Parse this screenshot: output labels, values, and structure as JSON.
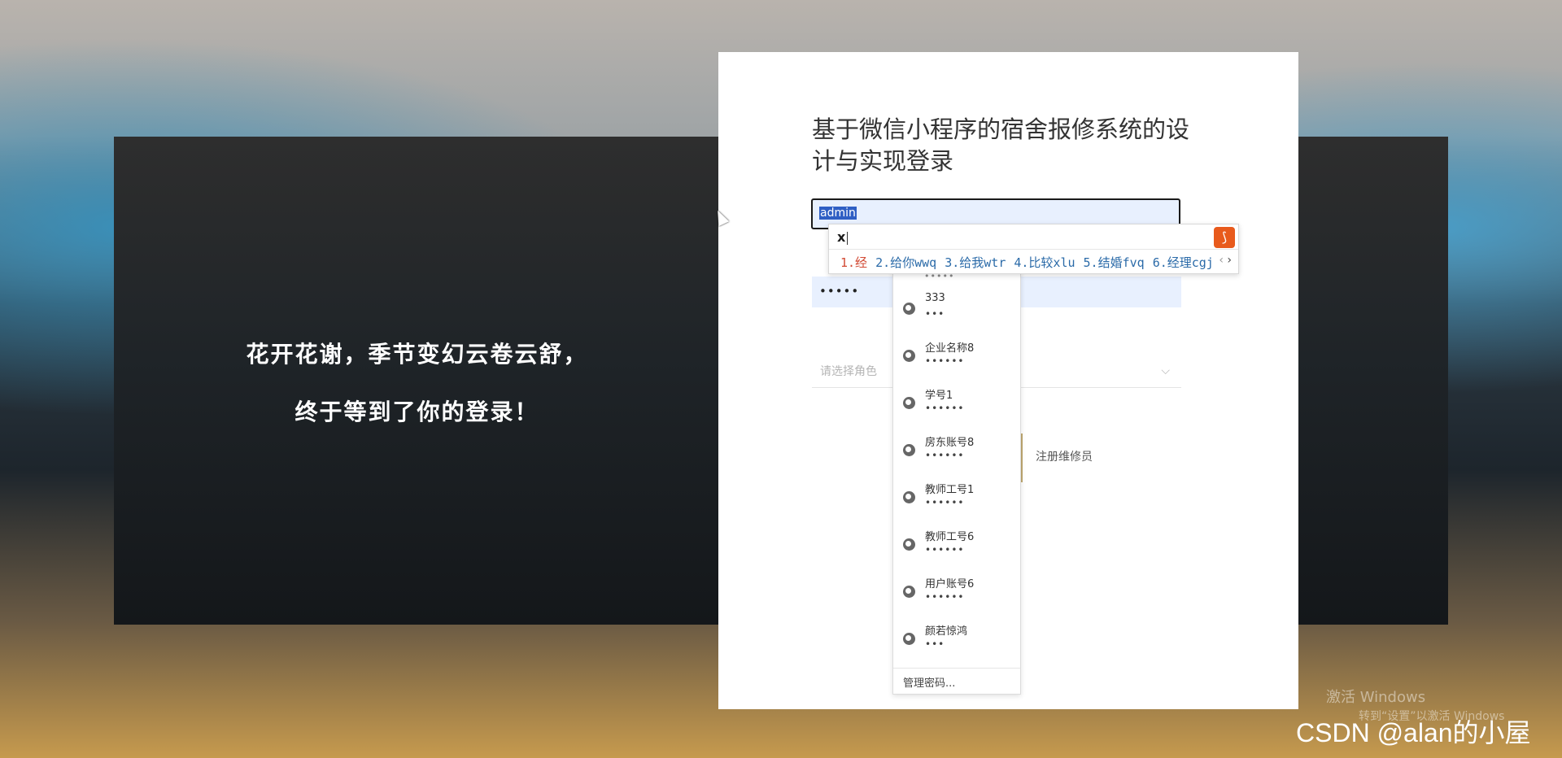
{
  "slogan": {
    "line1": "花开花谢，季节变幻云卷云舒，",
    "line2": "终于等到了你的登录！"
  },
  "login": {
    "title": "基于微信小程序的宿舍报修系统的设计与实现登录",
    "username_value": "admin",
    "password_mask": "•••••",
    "role_placeholder": "请选择角色",
    "register_label": "注册维修员"
  },
  "ime": {
    "input": "x",
    "candidates": [
      "1.经",
      "2.给你wwq",
      "3.给我wtr",
      "4.比较xlu",
      "5.结婚fvq",
      "6.经理cgj"
    ],
    "prev_arrow": "‹",
    "next_arrow": "›",
    "logo_icon": "sogou-logo-icon",
    "accent": "#e85a1c"
  },
  "saved_passwords": {
    "items": [
      {
        "user": "333",
        "mask": "•••"
      },
      {
        "user": "企业名称8",
        "mask": "••••••"
      },
      {
        "user": "学号1",
        "mask": "••••••"
      },
      {
        "user": "房东账号8",
        "mask": "••••••"
      },
      {
        "user": "教师工号1",
        "mask": "••••••"
      },
      {
        "user": "教师工号6",
        "mask": "••••••"
      },
      {
        "user": "用户账号6",
        "mask": "••••••"
      },
      {
        "user": "颜若惊鸿",
        "mask": "•••"
      }
    ],
    "footer": "管理密码..."
  },
  "overlay": {
    "windows_line1": "激活 Windows",
    "windows_line2": "转到“设置”以激活 Windows",
    "csdn": "CSDN @alan的小屋"
  }
}
